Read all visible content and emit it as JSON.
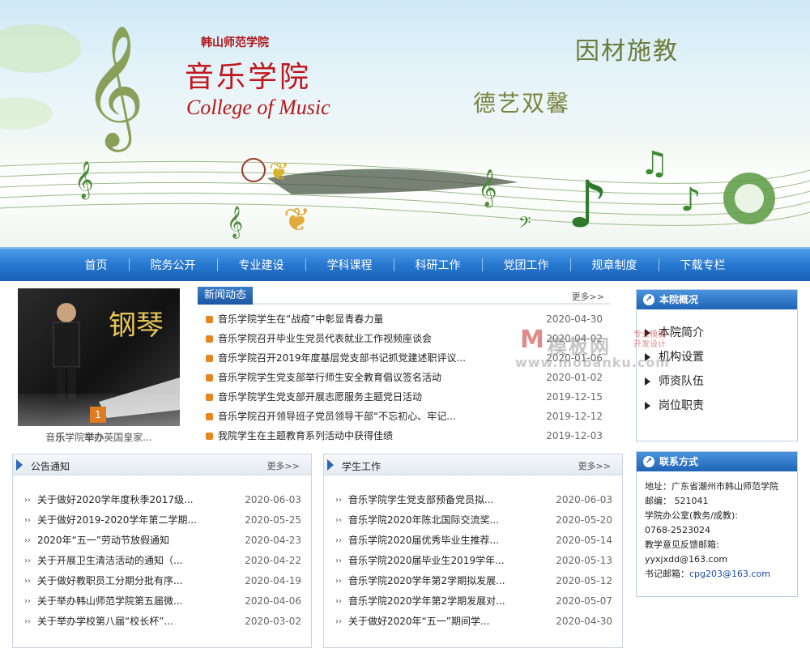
{
  "header": {
    "school_name": "韩山师范学院",
    "college_cn": "音乐学院",
    "college_en": "College of Music",
    "motto_1": "因材施教",
    "motto_2": "德艺双馨"
  },
  "nav": {
    "items": [
      "首页",
      "院务公开",
      "专业建设",
      "学科课程",
      "科研工作",
      "党团工作",
      "规章制度",
      "下载专栏"
    ]
  },
  "photo": {
    "title_art": "钢琴",
    "badge": "1",
    "caption_parts": [
      "音",
      "乐",
      "学院",
      "举办",
      "英国皇家..."
    ]
  },
  "news": {
    "title": "新闻动态",
    "more": "更多>>",
    "items": [
      {
        "title": "音乐学院学生在“战疫”中彰显青春力量",
        "date": "2020-04-30"
      },
      {
        "title": "音乐学院召开毕业生党员代表就业工作视频座谈会",
        "date": "2020-04-02"
      },
      {
        "title": "音乐学院召开2019年度基层党支部书记抓党建述职评议...",
        "date": "2020-01-06"
      },
      {
        "title": "音乐学院学生党支部举行师生安全教育倡议签名活动",
        "date": "2020-01-02"
      },
      {
        "title": "音乐学院学生党支部开展志愿服务主题党日活动",
        "date": "2019-12-15"
      },
      {
        "title": "音乐学院召开领导班子党员领导干部“不忘初心、牢记...",
        "date": "2019-12-12"
      },
      {
        "title": "我院学生在主题教育系列活动中获得佳绩",
        "date": "2019-12-03"
      }
    ]
  },
  "overview": {
    "title": "本院概况",
    "items": [
      "本院简介",
      "机构设置",
      "师资队伍",
      "岗位职责"
    ]
  },
  "contact": {
    "title": "联系方式",
    "address": "地址：广东省潮州市韩山师范学院",
    "postcode": "邮编： 521041",
    "office": "学院办公室(教务/成教):",
    "phone": "0768-2523024",
    "feedback_label": "教学意见反馈邮箱:",
    "feedback_email": "yyxjxdd@163.com",
    "secretary_label": "书记邮箱：",
    "secretary_email": "cpg203@163.com"
  },
  "notice": {
    "title": "公告通知",
    "more": "更多>>",
    "items": [
      {
        "title": "关于做好2020学年度秋季2017级...",
        "date": "2020-06-03"
      },
      {
        "title": "关于做好2019-2020学年第二学期...",
        "date": "2020-05-25"
      },
      {
        "title": "2020年“五一”劳动节放假通知",
        "date": "2020-04-23"
      },
      {
        "title": "关于开展卫生清洁活动的通知（...",
        "date": "2020-04-22"
      },
      {
        "title": "关于做好教职员工分期分批有序...",
        "date": "2020-04-19"
      },
      {
        "title": "关于举办韩山师范学院第五届微...",
        "date": "2020-04-06"
      },
      {
        "title": "关于举办学校第八届“校长杯”...",
        "date": "2020-03-02"
      }
    ]
  },
  "student": {
    "title": "学生工作",
    "more": "更多>>",
    "items": [
      {
        "title": "音乐学院学生党支部预备党员拟...",
        "date": "2020-06-03"
      },
      {
        "title": "音乐学院2020年陈北国际交流奖...",
        "date": "2020-05-20"
      },
      {
        "title": "音乐学院2020届优秀毕业生推荐...",
        "date": "2020-05-14"
      },
      {
        "title": "音乐学院2020届毕业生2019学年...",
        "date": "2020-05-13"
      },
      {
        "title": "音乐学院2020学年第2学期拟发展...",
        "date": "2020-05-12"
      },
      {
        "title": "音乐学院2020学年第2学期发展对...",
        "date": "2020-05-07"
      },
      {
        "title": "关于做好2020年“五一”期间学...",
        "date": "2020-04-30"
      }
    ]
  },
  "watermark": {
    "logo_m": "M",
    "logo_text": "模板网",
    "tag_1": "专业模板",
    "tag_2": "开发设计",
    "url": "www.mobanku.com"
  },
  "colors": {
    "nav_blue": "#2a7bd3",
    "title_red": "#c0161c",
    "motto_green": "#6d7b3a",
    "bullet_orange": "#e8851f"
  }
}
